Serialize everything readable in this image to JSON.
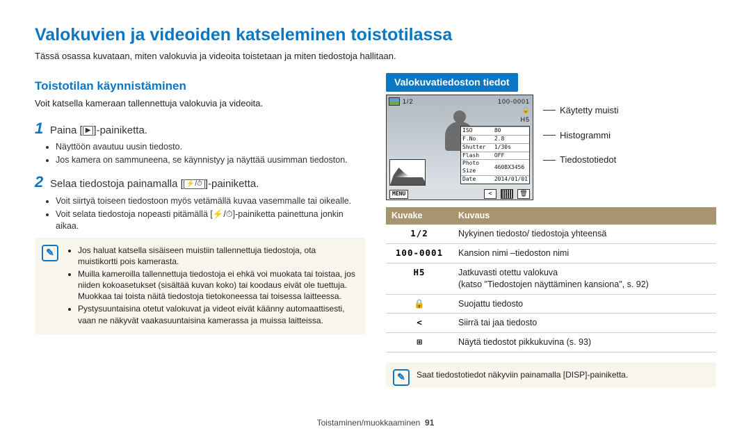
{
  "title": "Valokuvien ja videoiden katseleminen toistotilassa",
  "intro": "Tässä osassa kuvataan, miten valokuvia ja videoita toistetaan ja miten tiedostoja hallitaan.",
  "left": {
    "h2": "Toistotilan käynnistäminen",
    "sub": "Voit katsella kameraan tallennettuja valokuvia ja videoita.",
    "steps": [
      {
        "num": "1",
        "before": "Paina [",
        "iconGlyph": "▶",
        "after": "]-painiketta.",
        "bullets": [
          "Näyttöön avautuu uusin tiedosto.",
          "Jos kamera on sammuneena, se käynnistyy ja näyttää uusimman tiedoston."
        ]
      },
      {
        "num": "2",
        "before": "Selaa tiedostoja painamalla [",
        "iconGlyph": "⚡/⏱",
        "after": "]-painiketta.",
        "bullets": [
          "Voit siirtyä toiseen tiedostoon myös vetämällä kuvaa vasemmalle tai oikealle.",
          "Voit selata tiedostoja nopeasti pitämällä [⚡/⏱]-painiketta painettuna jonkin aikaa."
        ]
      }
    ],
    "noteIcon": "✎",
    "notes": [
      {
        "text": "Jos haluat katsella sisäiseen muistiin tallennettuja tiedostoja, ota muistikortti pois kamerasta.",
        "sub": []
      },
      {
        "text": "Muilla kameroilla tallennettuja tiedostoja ei ehkä voi muokata tai toistaa, jos niiden kokoasetukset (sisältää kuvan koko) tai koodaus eivät ole tuettuja. Muokkaa tai toista näitä tiedostoja tietokoneessa tai toisessa laitteessa.",
        "sub": []
      },
      {
        "text": "Pystysuuntaisina otetut valokuvat ja videot eivät käänny automaattisesti, vaan ne näkyvät vaakasuuntaisina kamerassa ja muissa laitteissa.",
        "sub": []
      }
    ]
  },
  "right": {
    "head": "Valokuvatiedoston tiedot",
    "preview": {
      "counter": "1/2",
      "folder": "100-0001",
      "iso_l": "ISO",
      "iso_v": "80",
      "fno_l": "F.No",
      "fno_v": "2.8",
      "sh_l": "Shutter",
      "sh_v": "1/30s",
      "fl_l": "Flash",
      "fl_v": "OFF",
      "ps_l": "Photo Size",
      "ps_v": "4608X3456",
      "dt_l": "Date",
      "dt_v": "2014/01/01",
      "lock": "🔒",
      "continuous": "H5",
      "menu": "MENU"
    },
    "callouts": {
      "c1": "Käytetty muisti",
      "c2": "Histogrammi",
      "c3": "Tiedostotiedot"
    },
    "table": {
      "h1": "Kuvake",
      "h2": "Kuvaus",
      "rows": [
        {
          "iconKey": "counter",
          "iconText": "1/2",
          "desc": "Nykyinen tiedosto/ tiedostoja yhteensä"
        },
        {
          "iconKey": "folder",
          "iconText": "100-0001",
          "desc": "Kansion nimi –tiedoston nimi"
        },
        {
          "iconKey": "cont",
          "iconText": "H5",
          "desc": "Jatkuvasti otettu valokuva\n(katso \"Tiedostojen näyttäminen kansiona\", s. 92)"
        },
        {
          "iconKey": "lock",
          "iconText": "🔒",
          "desc": "Suojattu tiedosto"
        },
        {
          "iconKey": "share",
          "iconText": "<",
          "desc": "Siirrä tai jaa tiedosto"
        },
        {
          "iconKey": "grid",
          "iconText": "⊞",
          "desc": "Näytä tiedostot pikkukuvina (s. 93)"
        }
      ]
    },
    "bottomNote": "Saat tiedostotiedot näkyviin painamalla [DISP]-painiketta."
  },
  "footer": {
    "section": "Toistaminen/muokkaaminen",
    "page": "91"
  }
}
